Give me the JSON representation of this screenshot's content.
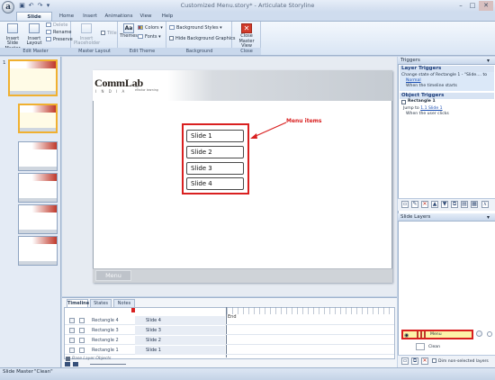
{
  "window": {
    "title": "Customized Menu.story* - Articulate Storyline",
    "app_orb_letter": "a",
    "controls": {
      "minimize": "–",
      "maximize": "□",
      "close": "✕"
    }
  },
  "ribbon": {
    "tabs": [
      {
        "label": "Slide Master"
      },
      {
        "label": "Home"
      },
      {
        "label": "Insert"
      },
      {
        "label": "Animations"
      },
      {
        "label": "View"
      },
      {
        "label": "Help"
      }
    ],
    "edit_master": {
      "label": "Edit Master",
      "insert_slide_master": "Insert Slide Master",
      "insert_layout": "Insert Layout",
      "delete": "Delete",
      "rename": "Rename",
      "preserve": "Preserve"
    },
    "master_layout": {
      "label": "Master Layout",
      "insert_placeholder": "Insert Placeholder",
      "title": "Title"
    },
    "edit_theme": {
      "label": "Edit Theme",
      "themes": "Themes",
      "colors": "Colors",
      "fonts": "Fonts"
    },
    "background": {
      "label": "Background",
      "background_styles": "Background Styles",
      "hide_background_graphics": "Hide Background Graphics"
    },
    "close": {
      "label": "Close",
      "close_master_view": "Close Master View"
    }
  },
  "thumbnails": [
    {
      "number": "1",
      "selected": true
    },
    {
      "number": "",
      "selected": true
    },
    {
      "number": "",
      "selected": false
    },
    {
      "number": "",
      "selected": false
    },
    {
      "number": "",
      "selected": false
    },
    {
      "number": "",
      "selected": false
    }
  ],
  "slide": {
    "logo_text": "CommLab",
    "logo_sub": "I N D I A",
    "logo_tagline_1": "for",
    "logo_tagline_2": "eFactor learning",
    "menu_items": [
      "Slide 1",
      "Slide 2",
      "Slide 3",
      "Slide 4"
    ],
    "annotation": "Menu items",
    "footer_button": "Menu"
  },
  "timeline": {
    "tabs": [
      "Timeline",
      "States",
      "Notes"
    ],
    "rows": [
      {
        "layer": "Rectangle 4",
        "object": "Slide 4"
      },
      {
        "layer": "Rectangle 3",
        "object": "Slide 3"
      },
      {
        "layer": "Rectangle 2",
        "object": "Slide 2"
      },
      {
        "layer": "Rectangle 1",
        "object": "Slide 1"
      }
    ],
    "end_label": "End",
    "base_layer_label": "Base Layer Objects"
  },
  "triggers": {
    "panel_title": "Triggers",
    "layer_triggers_header": "Layer Triggers",
    "layer_trigger_line1": "Change state of Rectangle 1 - \"Slide.... to",
    "layer_trigger_state": "Normal",
    "layer_trigger_when": "When the timeline starts",
    "object_triggers_header": "Object Triggers",
    "object_name": "Rectangle 1",
    "jump_prefix": "Jump to",
    "jump_link": "1.1 Slide 1",
    "jump_when": "When the user clicks"
  },
  "slide_layers": {
    "panel_title": "Slide Layers",
    "layers": [
      {
        "name": "Menu",
        "selected": true
      },
      {
        "name": "Clean",
        "selected": false
      }
    ],
    "dim_label": "Dim non-selected layers"
  },
  "status": {
    "view": "Slide Master",
    "theme": "\"Clean\""
  },
  "colors": {
    "annotation_red": "#d92020",
    "selection_yellow": "#fdf3a8",
    "ribbon_blue": "#d9e5f4"
  }
}
